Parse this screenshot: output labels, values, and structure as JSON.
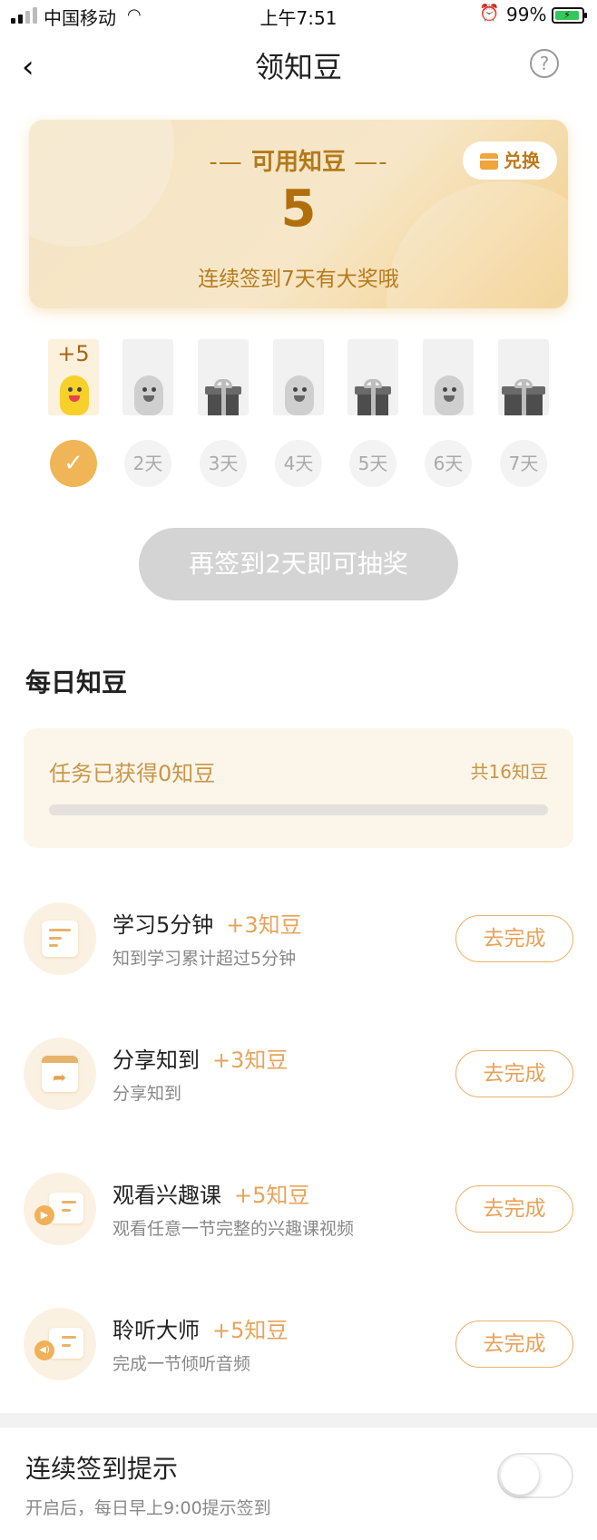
{
  "status_bar": {
    "carrier": "中国移动",
    "time": "上午7:51",
    "battery_pct": "99%"
  },
  "nav": {
    "title": "领知豆",
    "help_label": "?"
  },
  "balance": {
    "title": "可用知豆",
    "value": "5",
    "subtitle": "连续签到7天有大奖哦",
    "exchange_label": "兑换"
  },
  "checkin": {
    "first_day_bonus": "+5",
    "days": [
      "",
      "2天",
      "3天",
      "4天",
      "5天",
      "6天",
      "7天"
    ],
    "checked_days": 1,
    "lottery_label": "再签到2天即可抽奖"
  },
  "daily": {
    "section_title": "每日知豆",
    "progress_text": "任务已获得0知豆",
    "progress_total": "共16知豆",
    "progress_value": 0,
    "tasks": [
      {
        "title": "学习5分钟",
        "reward": "+3知豆",
        "desc": "知到学习累计超过5分钟",
        "button": "去完成",
        "icon": "study-icon"
      },
      {
        "title": "分享知到",
        "reward": "+3知豆",
        "desc": "分享知到",
        "button": "去完成",
        "icon": "share-icon"
      },
      {
        "title": "观看兴趣课",
        "reward": "+5知豆",
        "desc": "观看任意一节完整的兴趣课视频",
        "button": "去完成",
        "icon": "video-icon"
      },
      {
        "title": "聆听大师",
        "reward": "+5知豆",
        "desc": "完成一节倾听音频",
        "button": "去完成",
        "icon": "audio-icon"
      }
    ]
  },
  "reminder": {
    "title": "连续签到提示",
    "desc": "开启后，每日早上9:00提示签到",
    "enabled": false
  },
  "colors": {
    "accent": "#e8a25a",
    "gold_text": "#b06f0c",
    "disabled_button": "#d4d4d4"
  }
}
